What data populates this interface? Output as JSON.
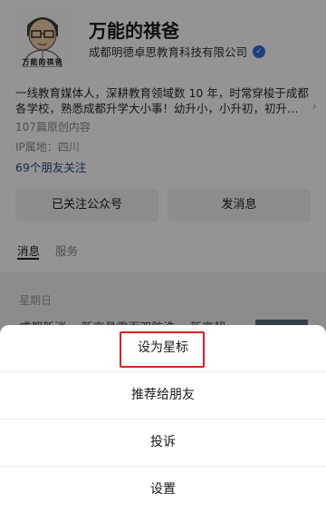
{
  "profile": {
    "avatar_label": "万能的祺爸",
    "name": "万能的祺爸",
    "org": "成都明德卓思教育科技有限公司",
    "bio_line1": "一线教育媒体人，深耕教育领域数 10 年，时常穿梭于成都",
    "bio_line2": "各学校，熟悉成都升学大小事！幼升小，小升初，初升…",
    "bio_more": "›",
    "article_count": "107篇原创内容",
    "ip_location": "IP属地：四川",
    "friends_follow": "69个朋友关注"
  },
  "actions": {
    "followed_label": "已关注公众号",
    "message_label": "发消息"
  },
  "tabs": [
    {
      "label": "消息"
    },
    {
      "label": "服务"
    }
  ],
  "feed": {
    "day_label": "星期日",
    "article_peek": "成都新消... 新京县雪面双防洗... 新京超"
  },
  "action_sheet": {
    "items": [
      {
        "label": "设为星标"
      },
      {
        "label": "推荐给朋友"
      },
      {
        "label": "投诉"
      },
      {
        "label": "设置"
      }
    ]
  },
  "colors": {
    "overlay": "rgba(0,0,0,0.42)",
    "highlight": "#e02020",
    "verify_badge": "#2e6fe0",
    "link": "#2a4a85"
  }
}
